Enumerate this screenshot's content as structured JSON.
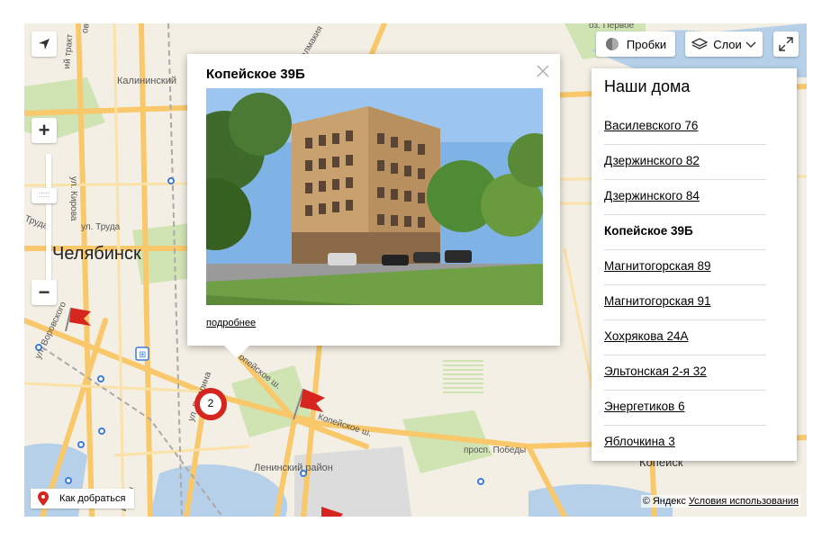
{
  "map": {
    "labels": {
      "city": "Челябинск",
      "district": "Ленинский район",
      "kopeysk": "Копейск",
      "kalininsky": "Калининский",
      "st_kirova": "ул. Кирова",
      "st_truda": "ул. Труда",
      "truda2": "Труда",
      "st_vorovskogo": "ул. Воровского",
      "st_gagarina": "ул. Гагарина",
      "kopeyskoe_sh1": "Копейское ш.",
      "kopeyskoe_sh2": "Копейское ш.",
      "prosp_pobedy": "просп. Победы",
      "oz_pervoe": "оз. Первое",
      "traktor": "ий тракт",
      "kalmakova": "алмакия",
      "ovskogo": "овского",
      "midian": "идиан"
    },
    "cluster_count": "2",
    "colors": {
      "road": "#f9c86a",
      "marker_red": "#d6241e",
      "water": "#b5d0e8",
      "park": "#cfe3b3"
    }
  },
  "controls": {
    "traffic_label": "Пробки",
    "layers_label": "Слои",
    "locate_icon": "arrow-locate-icon",
    "zoom_in": "+",
    "zoom_out": "−",
    "zoom_handle": ":::::"
  },
  "popup": {
    "title": "Копейское 39Б",
    "more_link": "подробнее"
  },
  "panel": {
    "title": "Наши дома",
    "items": [
      "Василевского 76",
      "Дзержинского 82",
      "Дзержинского 84",
      "Копейское 39Б",
      "Магнитогорская 89",
      "Магнитогорская 91",
      "Хохрякова 24А",
      "Эльтонская 2-я 32",
      "Энергетиков 6",
      "Яблочкина 3"
    ],
    "active_index": 3
  },
  "footer": {
    "route_label": "Как добраться",
    "copyright": "© Яндекс",
    "terms_link": "Условия использования"
  }
}
